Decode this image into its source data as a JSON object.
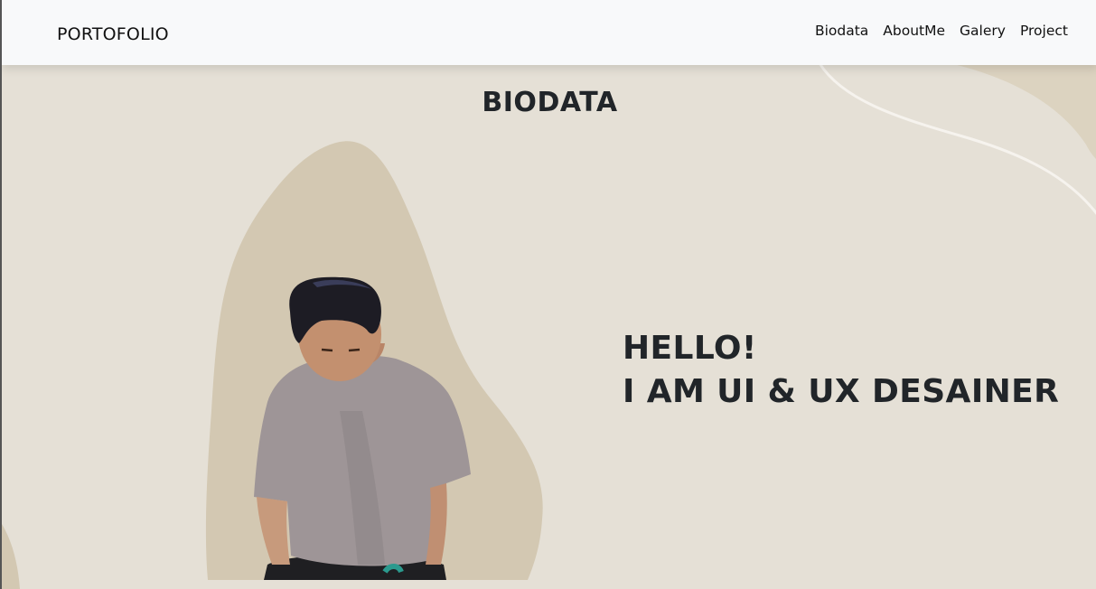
{
  "navbar": {
    "brand": "PORTOFOLIO",
    "links": [
      {
        "label": "Biodata"
      },
      {
        "label": "AboutMe"
      },
      {
        "label": "Galery"
      },
      {
        "label": "Project"
      }
    ]
  },
  "section": {
    "title": "BIODATA"
  },
  "hero": {
    "line1": "HELLO!",
    "line2": "I AM UI & UX DESAINER"
  },
  "colors": {
    "background": "#e5e0d6",
    "blob": "#d3c8b2",
    "navbar": "#f8f9fa",
    "text": "#212529"
  }
}
